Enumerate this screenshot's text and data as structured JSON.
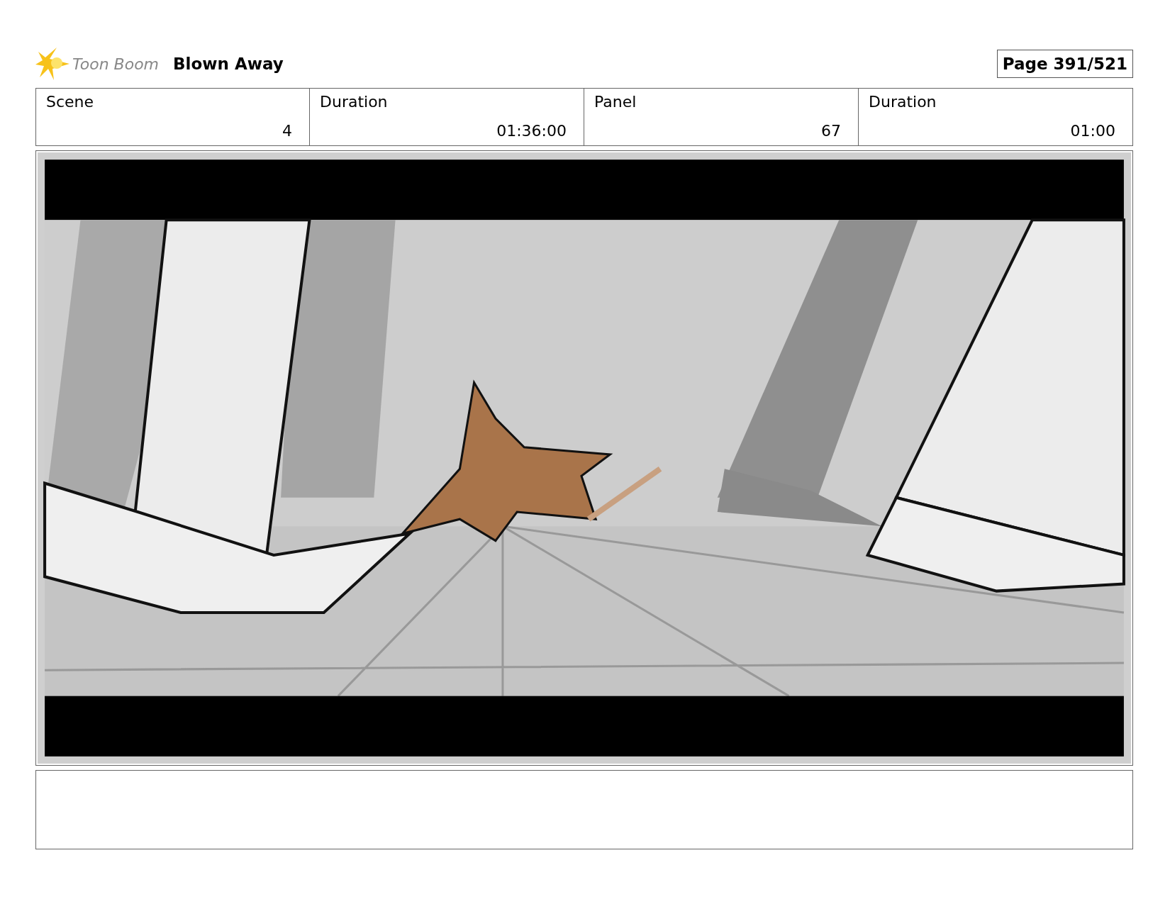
{
  "header": {
    "logo_text": "Toon Boom",
    "title": "Blown Away",
    "page": "Page 391/521"
  },
  "info": [
    {
      "label": "Scene",
      "value": "4"
    },
    {
      "label": "Duration",
      "value": "01:36:00"
    },
    {
      "label": "Panel",
      "value": "67"
    },
    {
      "label": "Duration",
      "value": "01:00"
    }
  ]
}
